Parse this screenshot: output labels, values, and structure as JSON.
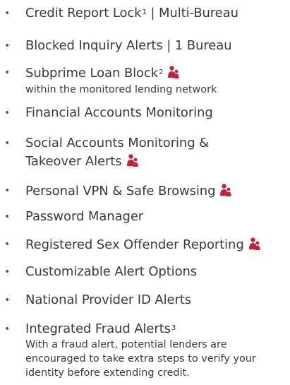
{
  "features": {
    "items": [
      {
        "label": "Credit Report Lock",
        "sup": "1",
        "suffix": " | Multi-Bureau"
      },
      {
        "label": "Blocked Inquiry Alerts | 1 Bureau"
      },
      {
        "label": "Subprime Loan Block",
        "sup": "2",
        "icon": "family-icon",
        "sub": "within the monitored lending network"
      },
      {
        "label": "Financial Accounts Monitoring"
      },
      {
        "line1": "Social Accounts Monitoring &",
        "line2": "Takeover Alerts",
        "icon": "family-icon"
      },
      {
        "label": "Personal VPN & Safe Browsing",
        "icon": "family-icon"
      },
      {
        "label": "Password Manager"
      },
      {
        "label": "Registered Sex Offender Reporting",
        "icon": "family-icon"
      },
      {
        "label": "Customizable Alert Options"
      },
      {
        "label": "National Provider ID Alerts"
      },
      {
        "label": "Integrated Fraud Alerts",
        "sup": "3",
        "desc1": "With a fraud alert, potential lenders are",
        "desc2": "encouraged to take extra steps to verify your",
        "desc3": "identity before extending credit."
      }
    ],
    "bullet": "•"
  },
  "colors": {
    "text": "#3a3a3a",
    "icon": "#c0233a"
  }
}
